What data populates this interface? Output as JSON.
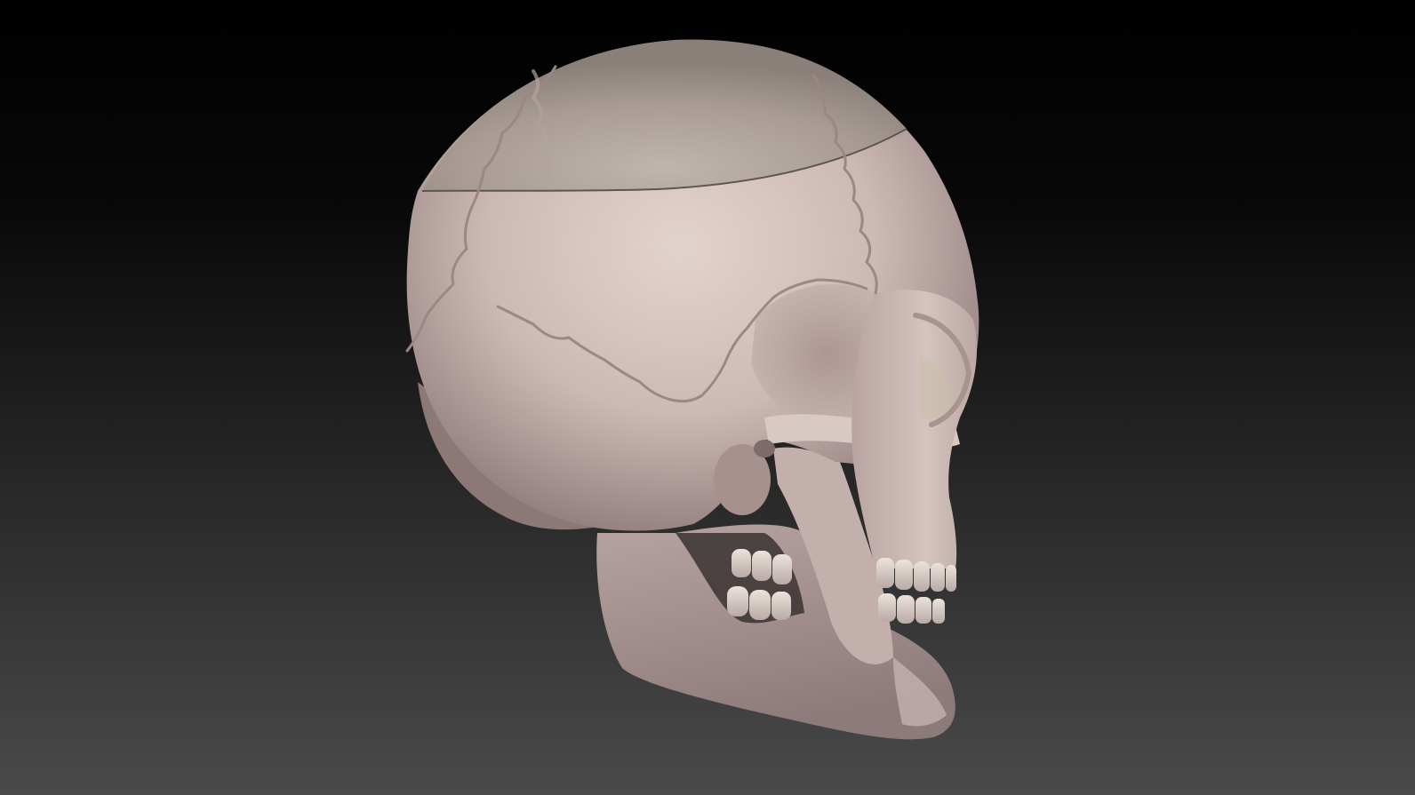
{
  "scene": {
    "background_top": "#000000",
    "background_bottom": "#4a4a4a",
    "subject": "skull-model",
    "material": {
      "base": "#cbb8b4",
      "shadow": "#8e7c7c",
      "highlight": "#e2d2cc",
      "cap": "#a69a93",
      "cap_highlight": "#bdb2ab",
      "suture": "#9c8784",
      "teeth": "#e6dcd5"
    }
  }
}
